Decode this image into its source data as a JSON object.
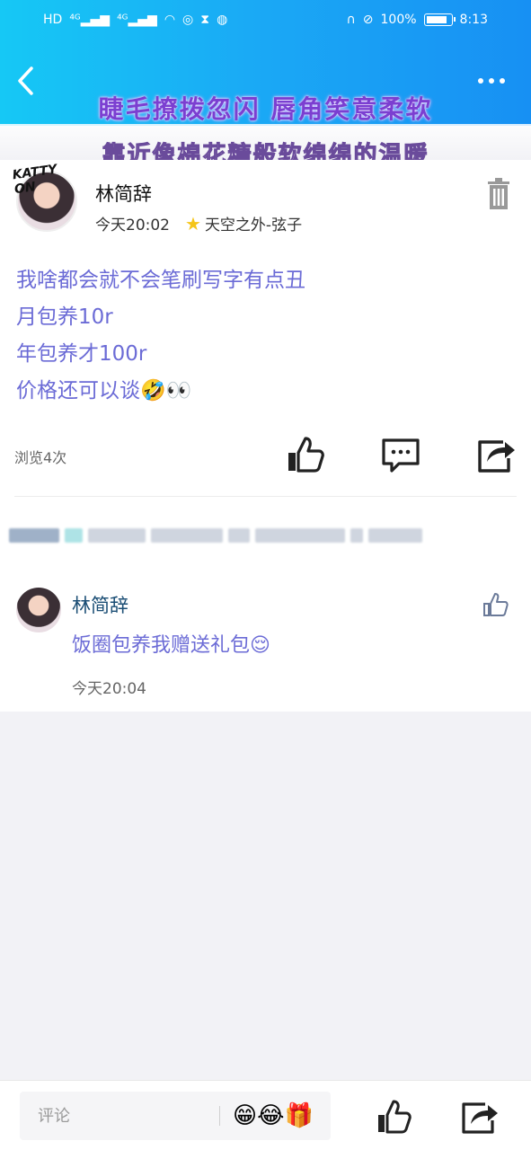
{
  "status_bar": {
    "left_icons": [
      "hd-icon",
      "4g-signal-icon",
      "4g-signal-icon",
      "wifi-icon",
      "hotspot-icon",
      "hourglass-icon",
      "globe-icon"
    ],
    "battery": "100%",
    "time": "8:13"
  },
  "header": {
    "deco_line1": "睫毛撩拨忽闪 唇角笑意柔软",
    "deco_line2": "靠近像棉花糖般软绵绵的温暖",
    "colors": {
      "start": "#16c8f5",
      "end": "#1790f3"
    }
  },
  "post": {
    "author": "林简辞",
    "time": "今天20:02",
    "topic": "天空之外-弦子",
    "badge": "KATTY ON",
    "lines": [
      "我啥都会就不会笔刷写字有点丑",
      "月包养10r",
      "年包养才100r",
      "价格还可以谈🤣👀"
    ],
    "views": "浏览4次"
  },
  "comment": {
    "author": "林简辞",
    "text": "饭圈包养我赠送礼包😌",
    "time": "今天20:04"
  },
  "bottom_bar": {
    "placeholder": "评论",
    "emojis": "😁😂🎁"
  }
}
